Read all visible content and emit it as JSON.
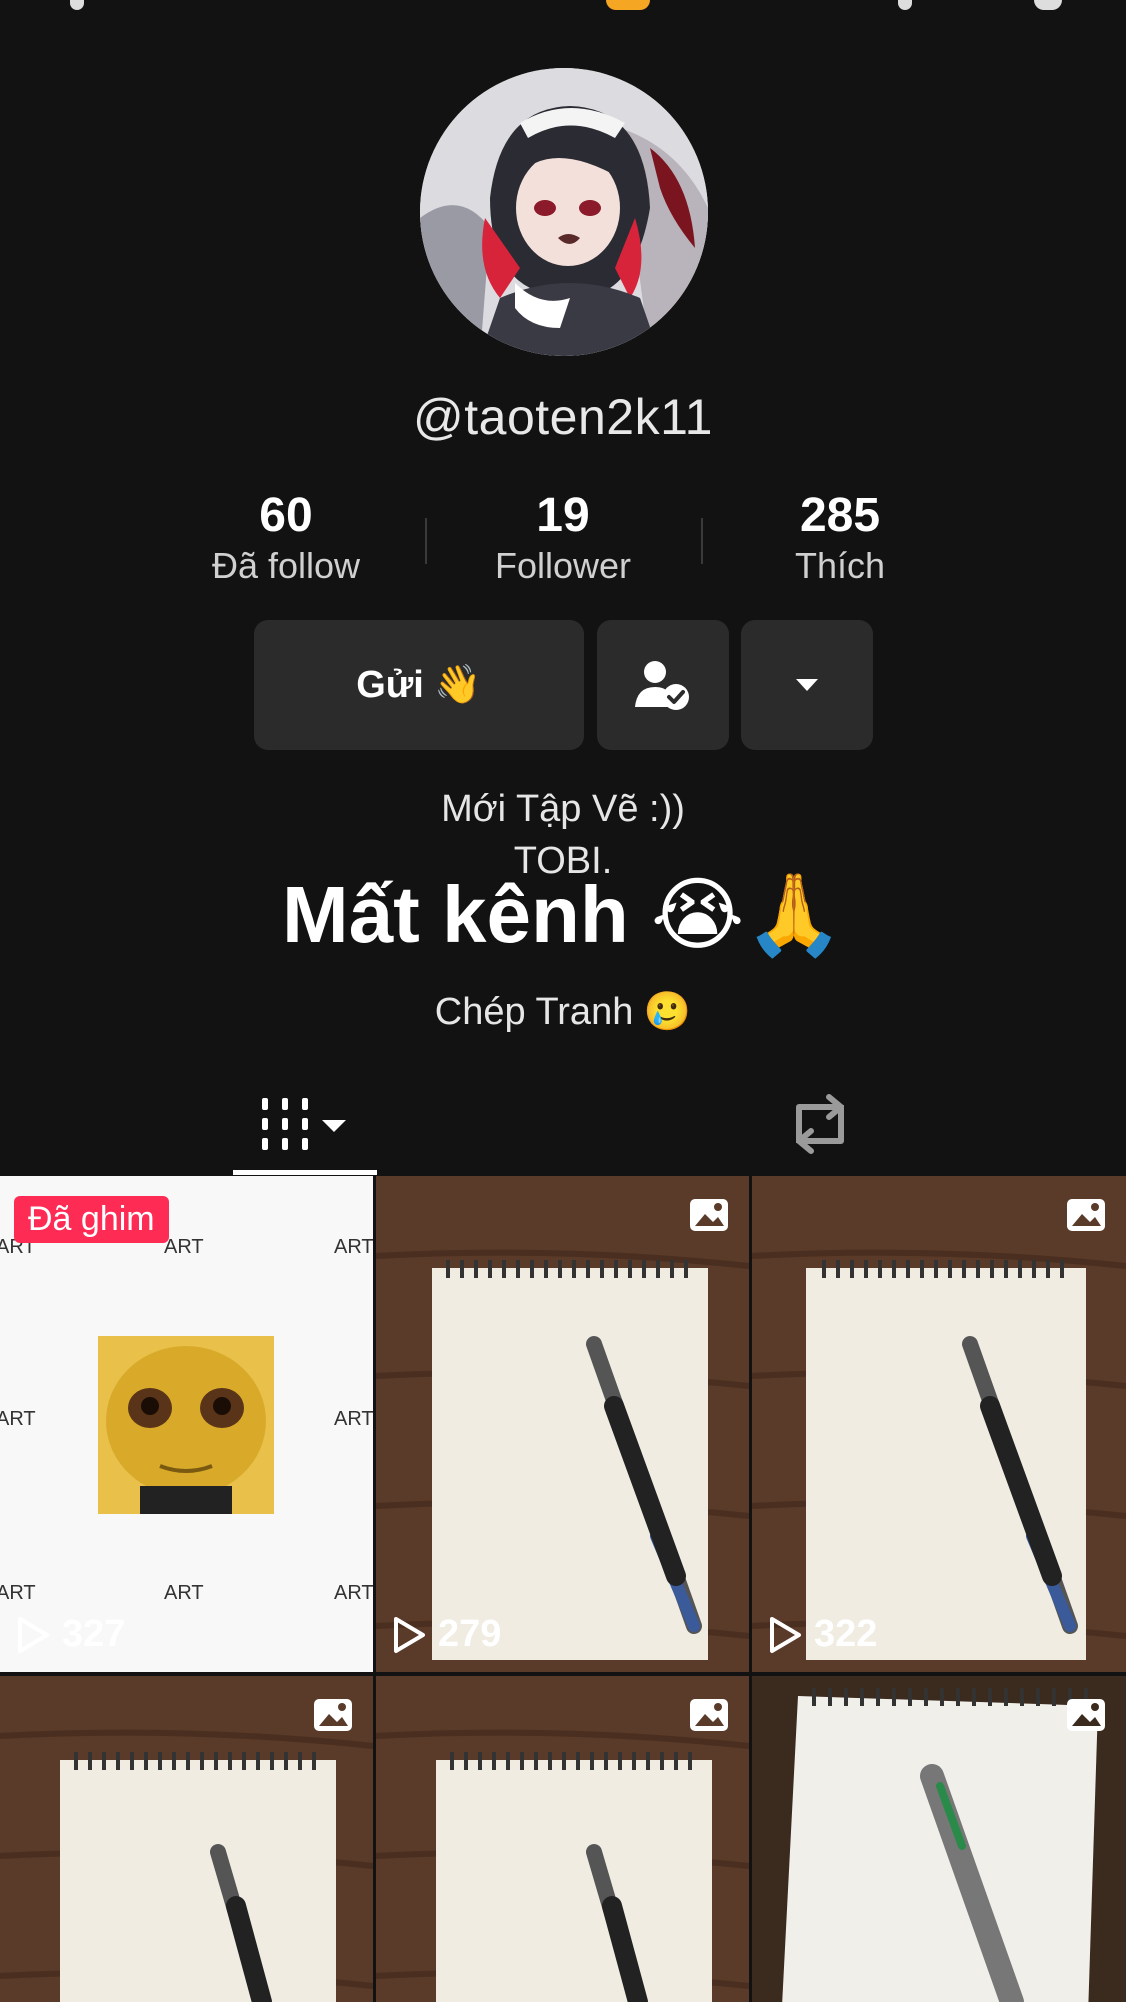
{
  "profile": {
    "username": "@taoten2k11",
    "avatar_icon": "anime-avatar"
  },
  "stats": [
    {
      "value": "60",
      "label": "Đã follow"
    },
    {
      "value": "19",
      "label": "Follower"
    },
    {
      "value": "285",
      "label": "Thích"
    }
  ],
  "actions": {
    "message_label": "Gửi 👋",
    "friend_icon": "user-check-icon",
    "more_icon": "caret-down-icon"
  },
  "bio": {
    "line1": "Mới  Tập Vẽ :))",
    "line2": "TOBI.",
    "line3": "Mất kênh 😭🙏",
    "line4": "Chép Tranh 🥲"
  },
  "tabs": [
    {
      "icon": "grid-icon",
      "selected": true
    },
    {
      "icon": "repost-icon",
      "selected": false
    }
  ],
  "videos": [
    {
      "views": "327",
      "pinned_label": "Đã ghim",
      "type": "pinned-art"
    },
    {
      "views": "279",
      "type": "photo"
    },
    {
      "views": "322",
      "type": "photo"
    },
    {
      "views": "",
      "type": "photo"
    },
    {
      "views": "",
      "type": "photo"
    },
    {
      "views": "",
      "type": "photo"
    }
  ],
  "art_watermark": "ART",
  "colors": {
    "background": "#121212",
    "button": "#2b2b2b",
    "pinned_badge": "#fe2c55"
  }
}
